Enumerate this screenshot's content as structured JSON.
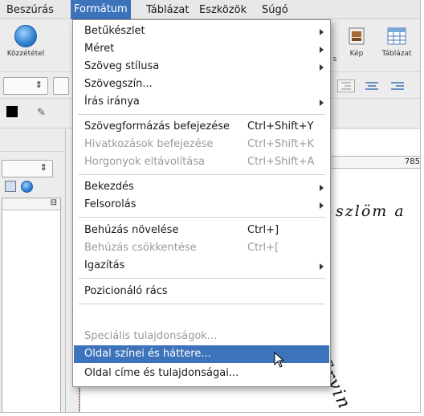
{
  "menubar": {
    "items": [
      {
        "label": "Beszúrás"
      },
      {
        "label": "Formátum"
      },
      {
        "label": "Táblázat"
      },
      {
        "label": "Eszközök"
      },
      {
        "label": "Súgó"
      }
    ]
  },
  "toolbar": {
    "publish_label": "Közzététel",
    "image_label": "Kép",
    "table_label": "Táblázat",
    "s_label": "s"
  },
  "ruler": {
    "value": "785"
  },
  "document": {
    "handwriting_1": "szlöm a",
    "handwriting_2": "Ervin"
  },
  "format_menu": {
    "items": [
      {
        "label": "Betűkészlet",
        "submenu": true
      },
      {
        "label": "Méret",
        "submenu": true
      },
      {
        "label": "Szöveg stílusa",
        "submenu": true
      },
      {
        "label": "Szövegszín..."
      },
      {
        "label": "Írás iránya",
        "submenu": true
      },
      {
        "label": "Szövegformázás befejezése",
        "shortcut": "Ctrl+Shift+Y"
      },
      {
        "label": "Hivatkozások befejezése",
        "shortcut": "Ctrl+Shift+K",
        "disabled": true
      },
      {
        "label": "Horgonyok eltávolítása",
        "shortcut": "Ctrl+Shift+A",
        "disabled": true
      },
      {
        "label": "Bekezdés",
        "submenu": true
      },
      {
        "label": "Felsorolás",
        "submenu": true
      },
      {
        "label": "Behúzás növelése",
        "shortcut": "Ctrl+]"
      },
      {
        "label": "Behúzás csökkentése",
        "shortcut": "Ctrl+[",
        "disabled": true
      },
      {
        "label": "Igazítás",
        "submenu": true
      },
      {
        "label": "Pozicionáló rács"
      },
      {
        "label": "Speciális tulajdonságok...",
        "disabled": true
      },
      {
        "label": "Oldal színei és háttere...",
        "highlighted": true
      },
      {
        "label": "Oldal címe és tulajdonságai..."
      }
    ]
  },
  "colors": {
    "highlight": "#3c73bb",
    "disabled_text": "#9a9a9a"
  }
}
